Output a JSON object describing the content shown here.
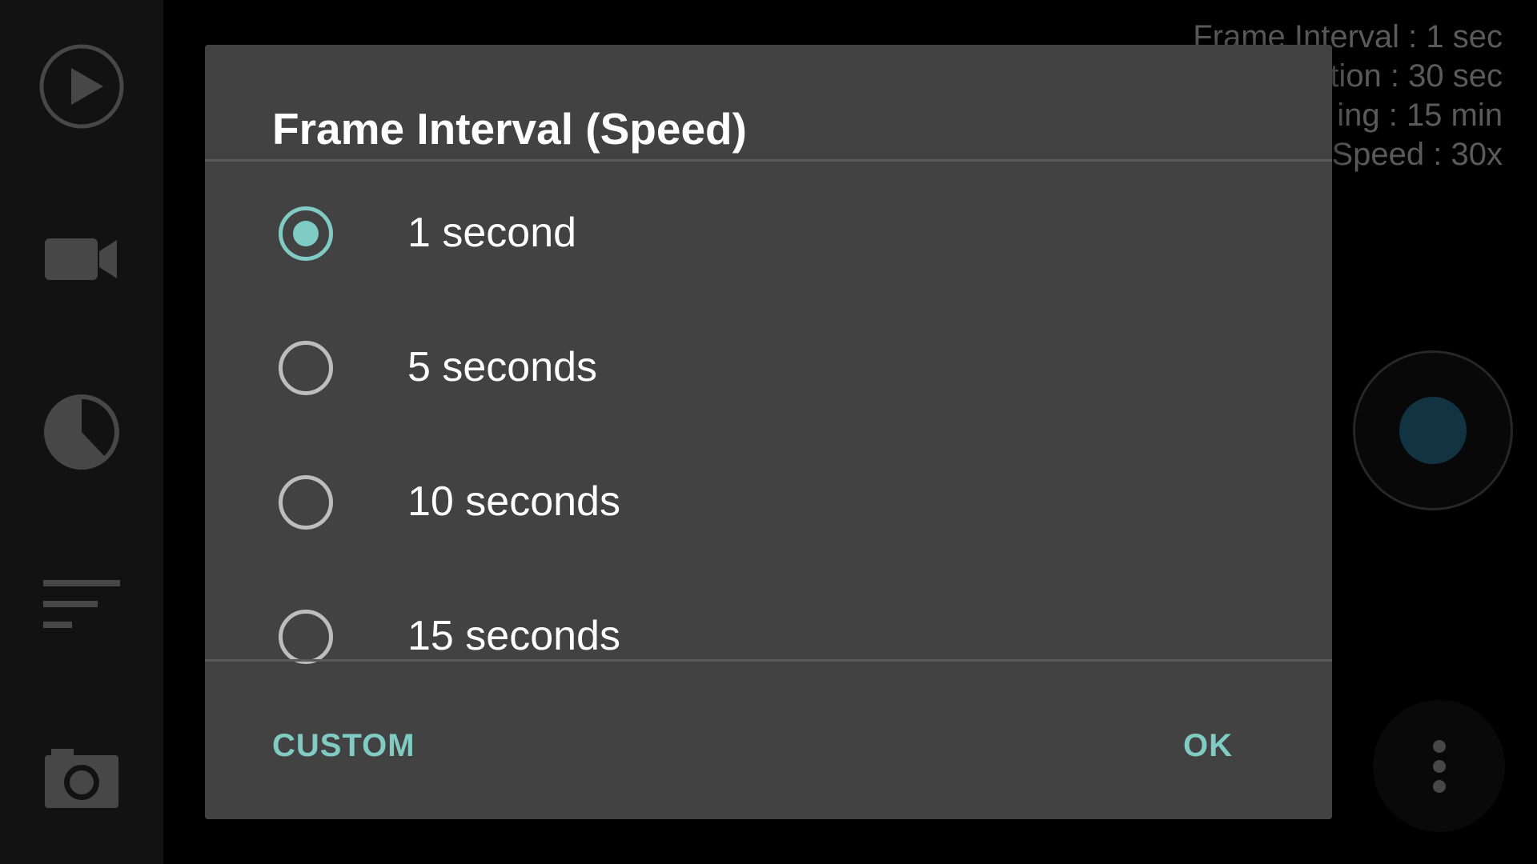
{
  "colors": {
    "accent": "#80cbc4",
    "dialog_background": "#424242",
    "sidebar_background": "#1c1c1c",
    "record_dot": "#1c4f66",
    "overlay_text": "#8a8a8a"
  },
  "sidebar": {
    "items": [
      {
        "icon": "play-circle-icon"
      },
      {
        "icon": "video-camera-icon"
      },
      {
        "icon": "clock-timer-icon"
      },
      {
        "icon": "sort-lines-icon"
      },
      {
        "icon": "camera-icon"
      }
    ]
  },
  "info_overlay": {
    "lines": [
      "Frame Interval : 1 sec",
      "tion : 30 sec",
      "ing : 15 min",
      "Speed : 30x"
    ]
  },
  "controls": {
    "record_icon": "record-icon",
    "more_icon": "more-vertical-icon"
  },
  "dialog": {
    "title": "Frame Interval (Speed)",
    "options": [
      {
        "label": "1 second",
        "selected": true
      },
      {
        "label": "5 seconds",
        "selected": false
      },
      {
        "label": "10 seconds",
        "selected": false
      },
      {
        "label": "15 seconds",
        "selected": false
      }
    ],
    "buttons": {
      "custom": "CUSTOM",
      "ok": "OK"
    }
  }
}
